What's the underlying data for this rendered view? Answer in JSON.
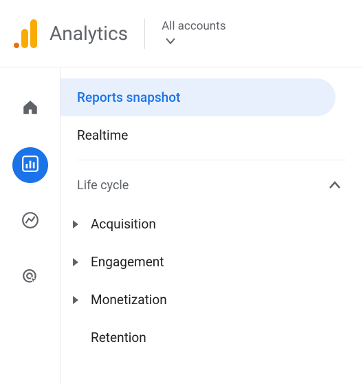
{
  "header": {
    "app_title": "Analytics",
    "account_label": "All accounts"
  },
  "rail": {
    "icons": [
      "home",
      "reports",
      "explore",
      "advertising"
    ],
    "active_index": 1
  },
  "nav": {
    "items": [
      {
        "label": "Reports snapshot",
        "selected": true
      },
      {
        "label": "Realtime",
        "selected": false
      }
    ],
    "section": {
      "title": "Life cycle",
      "expanded": true,
      "items": [
        {
          "label": "Acquisition",
          "has_children": true
        },
        {
          "label": "Engagement",
          "has_children": true
        },
        {
          "label": "Monetization",
          "has_children": true
        },
        {
          "label": "Retention",
          "has_children": false
        }
      ]
    }
  }
}
